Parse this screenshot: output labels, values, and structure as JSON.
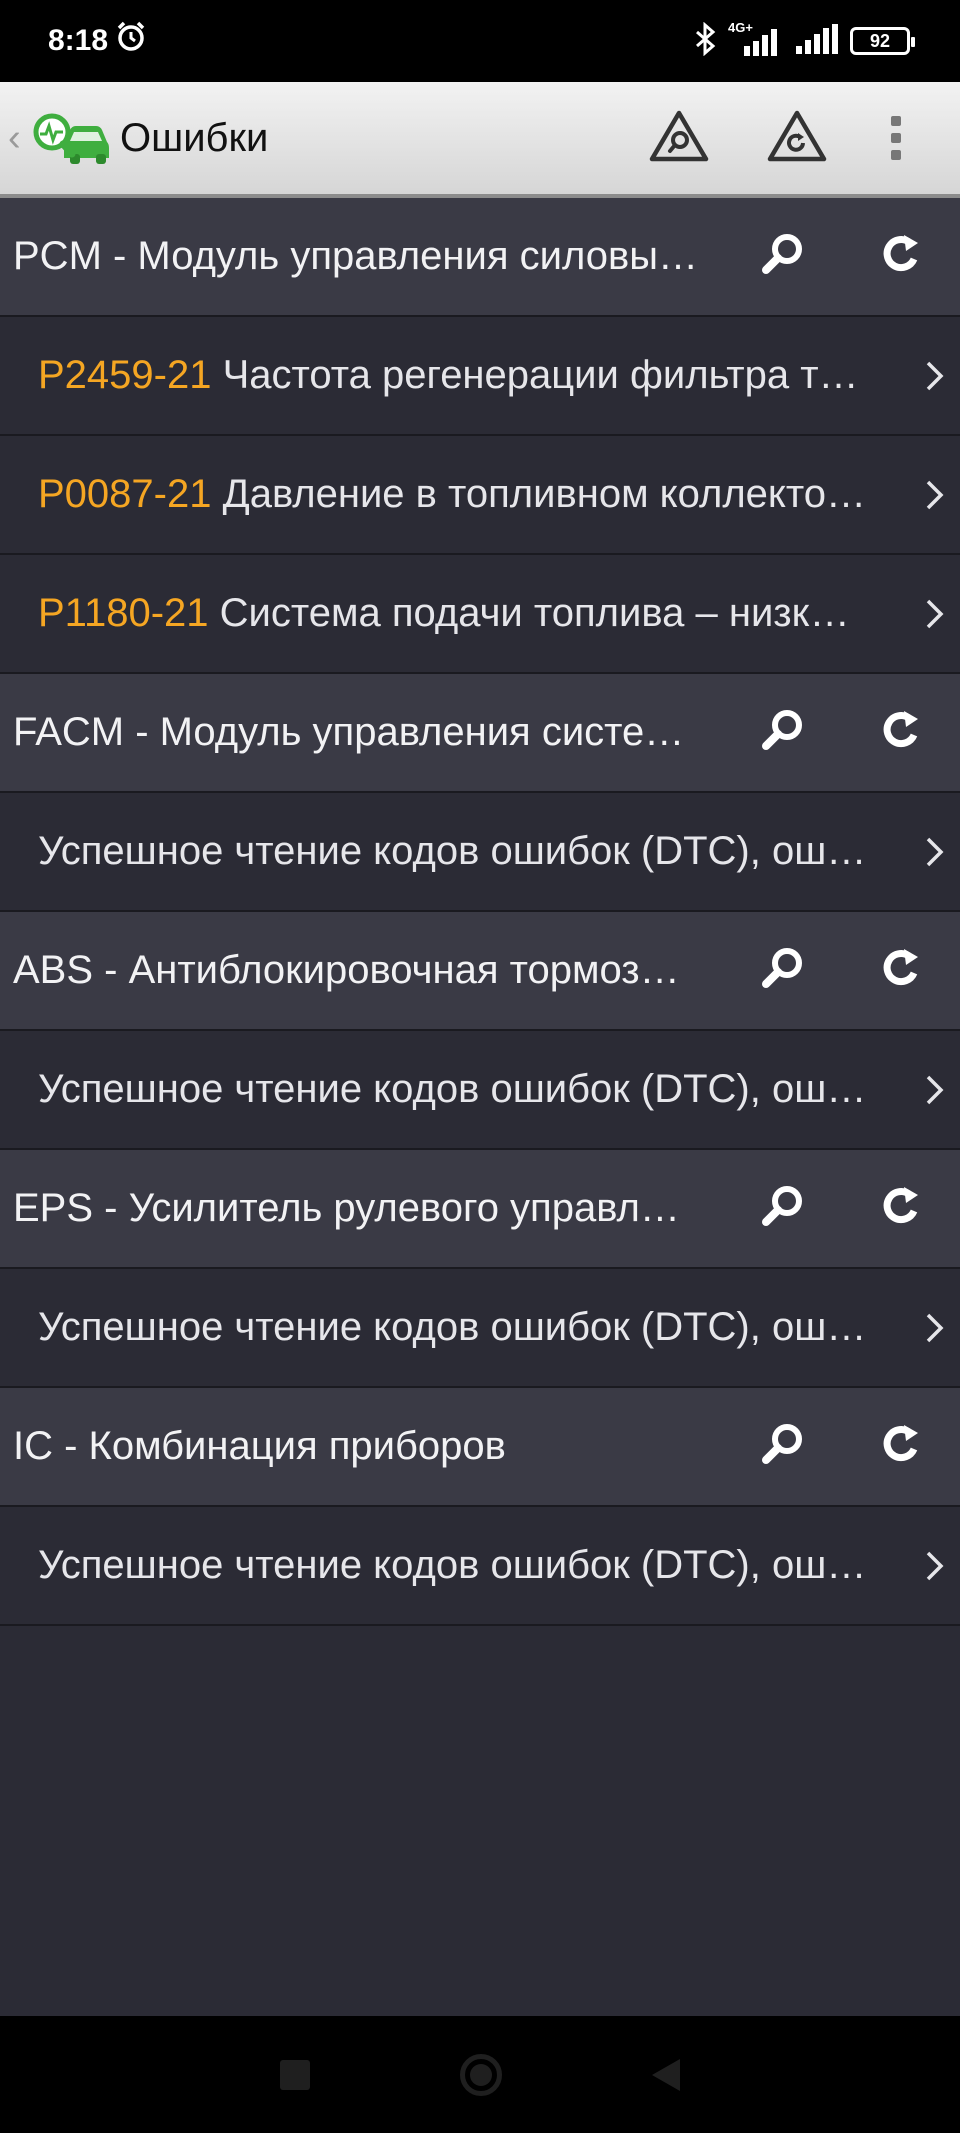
{
  "status_bar": {
    "time": "8:18",
    "alarm_icon": "alarm-icon",
    "bluetooth_icon": "bluetooth-icon",
    "network_label": "4G+",
    "battery": "92"
  },
  "app_bar": {
    "title": "Ошибки",
    "logo_icon": "car-diagnostic-logo",
    "actions": [
      {
        "icon": "warning-search-icon"
      },
      {
        "icon": "warning-refresh-icon"
      },
      {
        "icon": "overflow-menu-icon"
      }
    ]
  },
  "colors": {
    "dtc_code": "#f5a623",
    "module_bg": "#3a3a45",
    "item_bg": "#2b2b35",
    "logo_green": "#3fae3f"
  },
  "modules": [
    {
      "name": "PCM - Модуль управления силовым агрегатом",
      "items": [
        {
          "code": "P2459-21",
          "text": "Частота регенерации фильтра твердых частиц дизельного двигателя"
        },
        {
          "code": "P0087-21",
          "text": "Давление в топливном коллекторе/системе – слишком низкое"
        },
        {
          "code": "P1180-21",
          "text": "Система подачи топлива – низкое давление"
        }
      ]
    },
    {
      "name": "FACM - Модуль управления системой подачи топлива",
      "items": [
        {
          "code": "",
          "text": "Успешное чтение кодов ошибок (DTC), ошибок не обнаружено"
        }
      ]
    },
    {
      "name": "ABS - Антиблокировочная тормозная система",
      "items": [
        {
          "code": "",
          "text": "Успешное чтение кодов ошибок (DTC), ошибок не обнаружено"
        }
      ]
    },
    {
      "name": "EPS - Усилитель рулевого управления",
      "items": [
        {
          "code": "",
          "text": "Успешное чтение кодов ошибок (DTC), ошибок не обнаружено"
        }
      ]
    },
    {
      "name": "IC - Комбинация приборов",
      "items": [
        {
          "code": "",
          "text": "Успешное чтение кодов ошибок (DTC), ошибок не обнаружено"
        }
      ]
    }
  ]
}
